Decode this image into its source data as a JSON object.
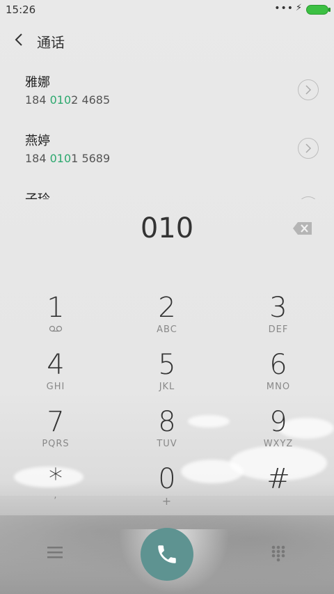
{
  "status": {
    "time": "15:26",
    "dots": "•••",
    "bolt": "⚡"
  },
  "header": {
    "title": "通话"
  },
  "contacts": [
    {
      "name": "雅娜",
      "num_prefix": "184 ",
      "num_match": "010",
      "num_suffix": "2 4685"
    },
    {
      "name": "燕婷",
      "num_prefix": "184 ",
      "num_match": "010",
      "num_suffix": "1 5689"
    },
    {
      "name": "子玲"
    }
  ],
  "dial": {
    "number": "010"
  },
  "keys": [
    {
      "digit": "1",
      "letters": ""
    },
    {
      "digit": "2",
      "letters": "ABC"
    },
    {
      "digit": "3",
      "letters": "DEF"
    },
    {
      "digit": "4",
      "letters": "GHI"
    },
    {
      "digit": "5",
      "letters": "JKL"
    },
    {
      "digit": "6",
      "letters": "MNO"
    },
    {
      "digit": "7",
      "letters": "PQRS"
    },
    {
      "digit": "8",
      "letters": "TUV"
    },
    {
      "digit": "9",
      "letters": "WXYZ"
    },
    {
      "digit": "*",
      "letters": ","
    },
    {
      "digit": "0",
      "letters": "+"
    },
    {
      "digit": "#",
      "letters": ""
    }
  ],
  "colors": {
    "accent_green": "#2ca86e",
    "call_button": "#5e9391",
    "battery": "#3cc043"
  },
  "icons": {
    "voicemail": "voicemail-icon",
    "delete": "backspace-icon",
    "menu": "menu-icon",
    "call": "phone-icon",
    "keypad": "dialpad-icon"
  }
}
